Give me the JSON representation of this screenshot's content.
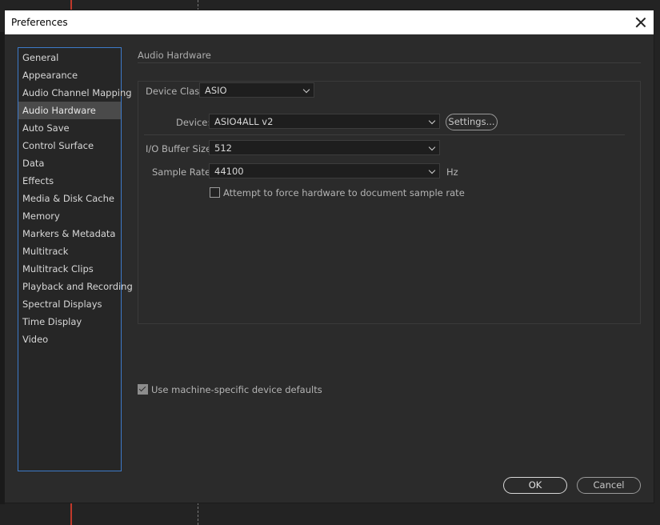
{
  "window": {
    "title": "Preferences"
  },
  "sidebar": {
    "items": [
      {
        "label": "General"
      },
      {
        "label": "Appearance"
      },
      {
        "label": "Audio Channel Mapping"
      },
      {
        "label": "Audio Hardware",
        "selected": true
      },
      {
        "label": "Auto Save"
      },
      {
        "label": "Control Surface"
      },
      {
        "label": "Data"
      },
      {
        "label": "Effects"
      },
      {
        "label": "Media & Disk Cache"
      },
      {
        "label": "Memory"
      },
      {
        "label": "Markers & Metadata"
      },
      {
        "label": "Multitrack"
      },
      {
        "label": "Multitrack Clips"
      },
      {
        "label": "Playback and Recording"
      },
      {
        "label": "Spectral Displays"
      },
      {
        "label": "Time Display"
      },
      {
        "label": "Video"
      }
    ]
  },
  "panel": {
    "heading": "Audio Hardware",
    "device_class": {
      "label": "Device Class:",
      "value": "ASIO"
    },
    "device": {
      "label": "Device:",
      "value": "ASIO4ALL v2",
      "settings_label": "Settings..."
    },
    "buffer_size": {
      "label": "I/O Buffer Size:",
      "value": "512"
    },
    "sample_rate": {
      "label": "Sample Rate:",
      "value": "44100",
      "unit": "Hz"
    },
    "force_rate": {
      "label": "Attempt to force hardware to document sample rate",
      "checked": false
    },
    "machine_defaults": {
      "label": "Use machine-specific device defaults",
      "checked": true
    }
  },
  "footer": {
    "ok_label": "OK",
    "cancel_label": "Cancel"
  },
  "colors": {
    "accent": "#3d7ac9",
    "background": "#2b2b2b",
    "selected": "#4a4a4a"
  }
}
